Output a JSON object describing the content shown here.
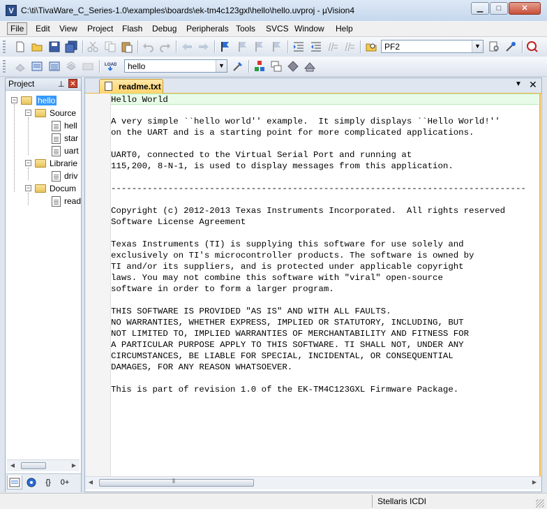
{
  "window": {
    "title": "C:\\ti\\TivaWare_C_Series-1.0\\examples\\boards\\ek-tm4c123gxl\\hello\\hello.uvproj - µVision4",
    "app_icon_letter": "V",
    "minimize_glyph": "▁",
    "maximize_glyph": "□",
    "close_glyph": "✕"
  },
  "menu": {
    "items": [
      "File",
      "Edit",
      "View",
      "Project",
      "Flash",
      "Debug",
      "Peripherals",
      "Tools",
      "SVCS",
      "Window",
      "Help"
    ],
    "active": "File"
  },
  "toolbar1": {
    "find_combo_value": "PF2"
  },
  "toolbar2": {
    "target_combo_value": "hello"
  },
  "project_panel": {
    "title": "Project",
    "pin_glyph": "📌",
    "close_glyph": "✕",
    "tree": {
      "root": "hello",
      "groups": [
        {
          "label": "Source",
          "files": [
            "hell",
            "star",
            "uart"
          ]
        },
        {
          "label": "Librarie",
          "files": [
            "driv"
          ]
        },
        {
          "label": "Docum",
          "files": [
            "read"
          ]
        }
      ]
    },
    "bottom_tabs": [
      "Project",
      "Books",
      "Functions",
      "Templates"
    ],
    "bottom_tab_glyphs": [
      "",
      "",
      "{}",
      "0+"
    ]
  },
  "editor": {
    "active_tab": "readme.txt",
    "dropdown_glyph": "▼",
    "close_glyph": "✕",
    "lines": [
      "Hello World",
      "",
      "A very simple ``hello world'' example.  It simply displays ``Hello World!''",
      "on the UART and is a starting point for more complicated applications.",
      "",
      "UART0, connected to the Virtual Serial Port and running at",
      "115,200, 8-N-1, is used to display messages from this application.",
      "",
      "--------------------------------------------------------------------------------",
      "",
      "Copyright (c) 2012-2013 Texas Instruments Incorporated.  All rights reserved",
      "Software License Agreement",
      "",
      "Texas Instruments (TI) is supplying this software for use solely and",
      "exclusively on TI's microcontroller products. The software is owned by",
      "TI and/or its suppliers, and is protected under applicable copyright",
      "laws. You may not combine this software with \"viral\" open-source",
      "software in order to form a larger program.",
      "",
      "THIS SOFTWARE IS PROVIDED \"AS IS\" AND WITH ALL FAULTS.",
      "NO WARRANTIES, WHETHER EXPRESS, IMPLIED OR STATUTORY, INCLUDING, BUT",
      "NOT LIMITED TO, IMPLIED WARRANTIES OF MERCHANTABILITY AND FITNESS FOR",
      "A PARTICULAR PURPOSE APPLY TO THIS SOFTWARE. TI SHALL NOT, UNDER ANY",
      "CIRCUMSTANCES, BE LIABLE FOR SPECIAL, INCIDENTAL, OR CONSEQUENTIAL",
      "DAMAGES, FOR ANY REASON WHATSOEVER.",
      "",
      "This is part of revision 1.0 of the EK-TM4C123GXL Firmware Package."
    ],
    "current_line": 1
  },
  "status": {
    "debugger": "Stellaris ICDI"
  },
  "icons": {
    "toolbar1": [
      "new-file-icon",
      "open-file-icon",
      "save-icon",
      "save-all-icon",
      "cut-icon",
      "copy-icon",
      "paste-icon",
      "undo-icon",
      "redo-icon",
      "navigate-back-icon",
      "navigate-forward-icon",
      "bookmark-icon",
      "bookmark-prev-icon",
      "bookmark-next-icon",
      "bookmark-clear-icon",
      "indent-icon",
      "unindent-icon",
      "comment-icon",
      "uncomment-icon",
      "find-in-files-icon",
      "find-icon",
      "debug-session-icon",
      "zoom-icon"
    ],
    "toolbar2": [
      "translate-icon",
      "build-icon",
      "rebuild-icon",
      "batch-build-icon",
      "stop-build-icon",
      "download-icon",
      "target-options-icon",
      "manage-components-icon",
      "file-extensions-icon",
      "books-window-icon",
      "config-wizard-icon"
    ]
  },
  "colors": {
    "accent_tab": "#ffd36b",
    "current_line": "#e8fbe8",
    "chrome": "#dfe6ef"
  }
}
